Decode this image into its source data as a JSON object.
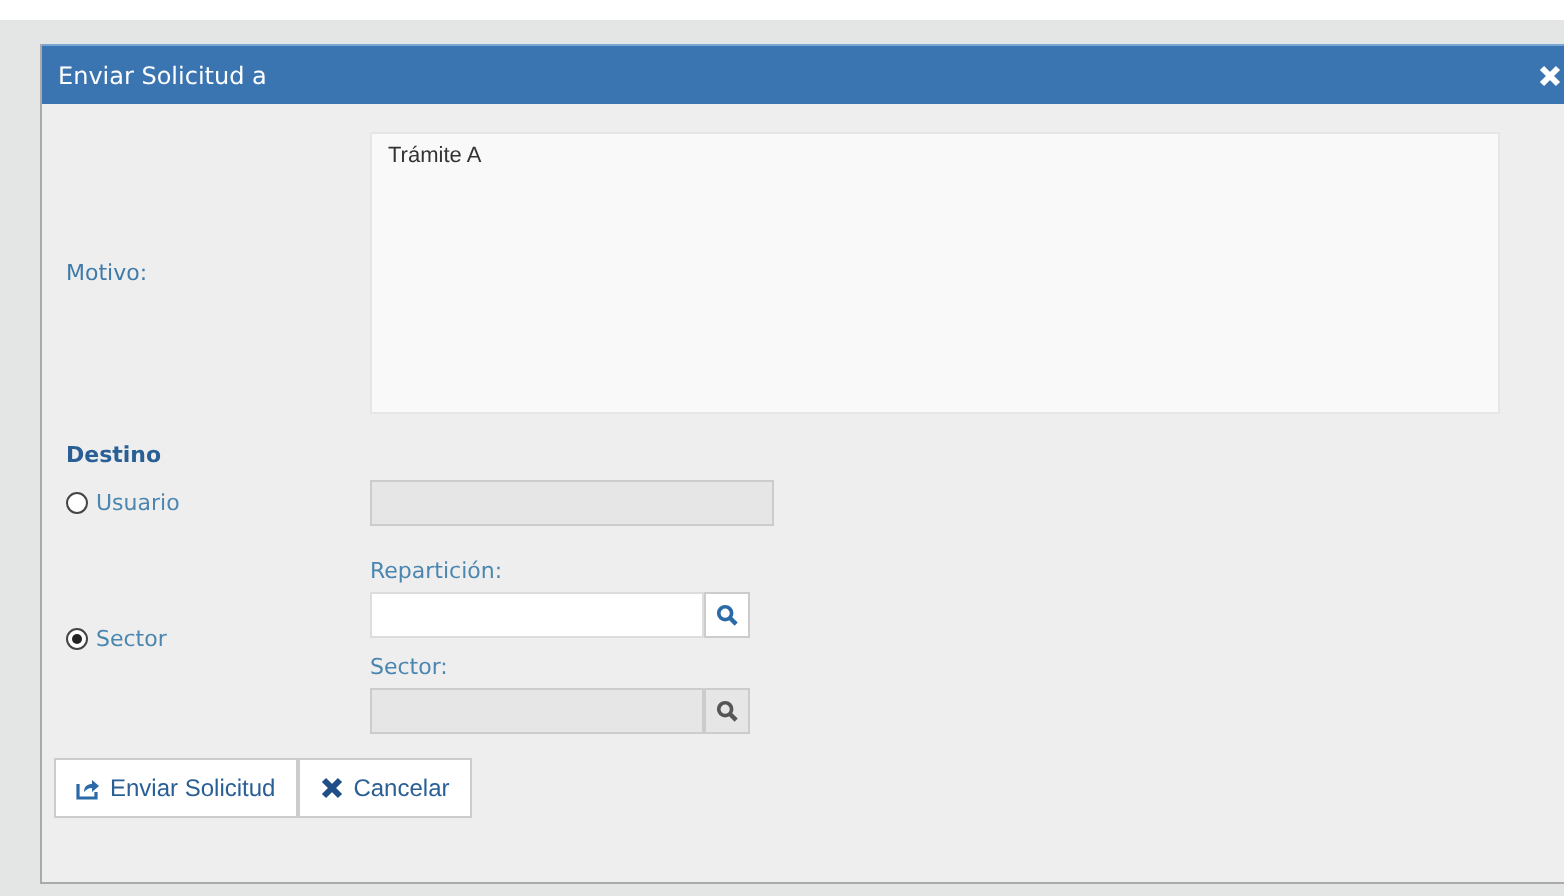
{
  "dialog": {
    "title": "Enviar Solicitud a"
  },
  "motivo": {
    "label": "Motivo:",
    "value": "Trámite A"
  },
  "destino": {
    "heading": "Destino",
    "options": [
      {
        "kind": "usuario",
        "label": "Usuario",
        "selected": false
      },
      {
        "kind": "sector",
        "label": "Sector",
        "selected": true
      }
    ]
  },
  "usuario_field": {
    "disabled": true
  },
  "reparticion": {
    "label": "Repartición:",
    "disabled": false
  },
  "sector": {
    "label": "Sector:",
    "disabled": true
  },
  "buttons": [
    {
      "kind": "submit",
      "label": "Enviar Solicitud"
    },
    {
      "kind": "cancel",
      "label": "Cancelar"
    }
  ]
}
